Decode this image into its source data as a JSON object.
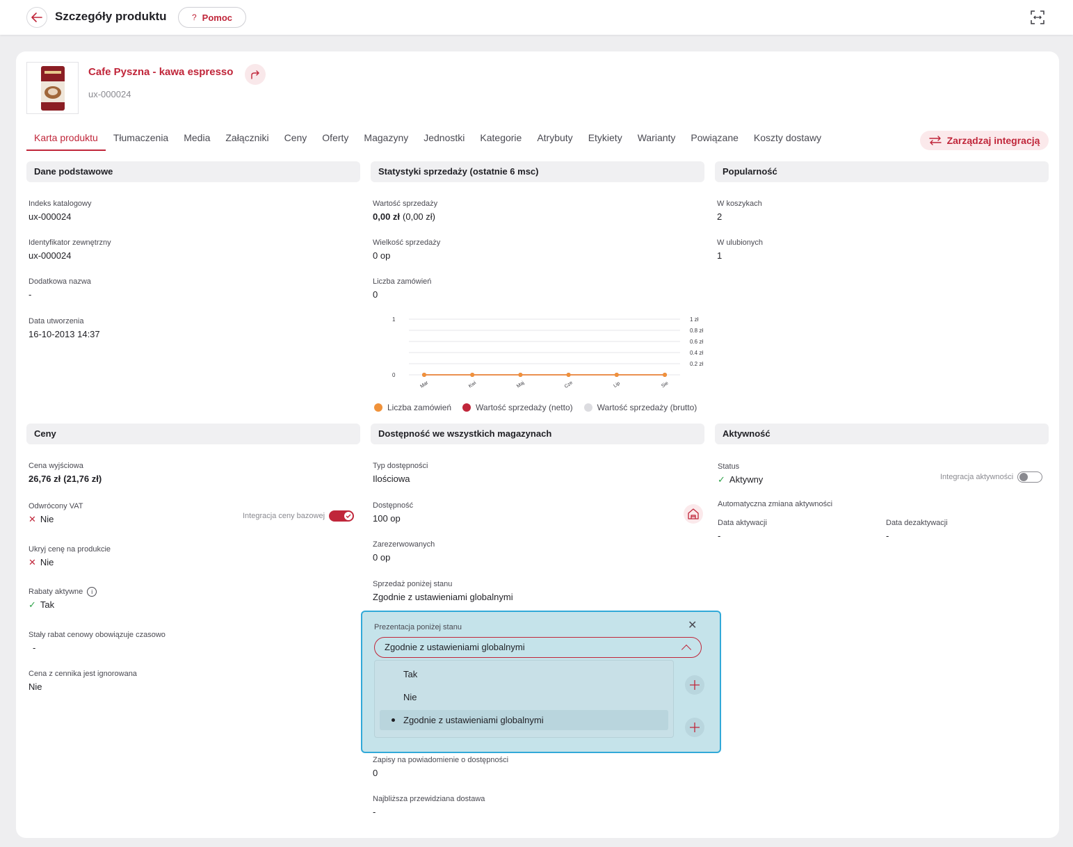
{
  "header": {
    "title": "Szczegóły produktu",
    "help_label": "Pomoc",
    "help_glyph": "?"
  },
  "product": {
    "name": "Cafe Pyszna - kawa espresso",
    "sku": "ux-000024"
  },
  "tabs": [
    {
      "label": "Karta produktu",
      "active": true
    },
    {
      "label": "Tłumaczenia"
    },
    {
      "label": "Media"
    },
    {
      "label": "Załączniki"
    },
    {
      "label": "Ceny"
    },
    {
      "label": "Oferty"
    },
    {
      "label": "Magazyny"
    },
    {
      "label": "Jednostki"
    },
    {
      "label": "Kategorie"
    },
    {
      "label": "Atrybuty"
    },
    {
      "label": "Etykiety"
    },
    {
      "label": "Warianty"
    },
    {
      "label": "Powiązane"
    },
    {
      "label": "Koszty dostawy"
    }
  ],
  "integration_button": "Zarządzaj integracją",
  "basic": {
    "title": "Dane podstawowe",
    "catalog_index_label": "Indeks katalogowy",
    "catalog_index": "ux-000024",
    "external_id_label": "Identyfikator zewnętrzny",
    "external_id": "ux-000024",
    "extra_name_label": "Dodatkowa nazwa",
    "extra_name": "-",
    "created_label": "Data utworzenia",
    "created": "16-10-2013 14:37"
  },
  "sales": {
    "title": "Statystyki sprzedaży (ostatnie 6 msc)",
    "value_label": "Wartość sprzedaży",
    "value_main": "0,00 zł",
    "value_extra": "(0,00 zł)",
    "volume_label": "Wielkość sprzedaży",
    "volume": "0 op",
    "orders_label": "Liczba zamówień",
    "orders": "0"
  },
  "popularity": {
    "title": "Popularność",
    "carts_label": "W koszykach",
    "carts": "2",
    "favs_label": "W ulubionych",
    "favs": "1"
  },
  "prices": {
    "title": "Ceny",
    "base_price_label": "Cena wyjściowa",
    "base_price_main": "26,76 zł",
    "base_price_extra": "(21,76 zł)",
    "reverse_vat_label": "Odwrócony VAT",
    "reverse_vat": "Nie",
    "base_integration_label": "Integracja ceny bazowej",
    "hide_price_label": "Ukryj cenę na produkcie",
    "hide_price": "Nie",
    "discounts_label": "Rabaty aktywne",
    "discounts": "Tak",
    "fixed_discount_label": "Stały rabat cenowy obowiązuje czasowo",
    "fixed_discount": "-",
    "ignored_label": "Cena z cennika jest ignorowana",
    "ignored": "Nie"
  },
  "availability": {
    "title": "Dostępność we wszystkich magazynach",
    "type_label": "Typ dostępności",
    "type": "Ilościowa",
    "avail_label": "Dostępność",
    "avail": "100 op",
    "reserved_label": "Zarezerwowanych",
    "reserved": "0 op",
    "below_label": "Sprzedaż poniżej stanu",
    "below": "Zgodnie z ustawieniami globalnymi",
    "notify_label": "Zapisy na powiadomienie o dostępności",
    "notify": "0",
    "next_delivery_label": "Najbliższa przewidziana dostawa",
    "next_delivery": "-"
  },
  "activity": {
    "title": "Aktywność",
    "status_label": "Status",
    "status": "Aktywny",
    "integration_label": "Integracja aktywności",
    "auto_label": "Automatyczna zmiana aktywności",
    "activation_label": "Data aktywacji",
    "activation": "-",
    "deactivation_label": "Data dezaktywacji",
    "deactivation": "-"
  },
  "popup": {
    "label": "Prezentacja poniżej stanu",
    "selected": "Zgodnie z ustawieniami globalnymi",
    "options": [
      "Tak",
      "Nie",
      "Zgodnie z ustawieniami globalnymi"
    ]
  },
  "colors": {
    "accent": "#c0263a",
    "orders_series": "#f0923a",
    "net_series": "#c0263a",
    "gross_series": "#dcdce0",
    "popup_border": "#31a9d8"
  },
  "chart_data": {
    "type": "line",
    "categories": [
      "Mar",
      "Kwi",
      "Maj",
      "Cze",
      "Lip",
      "Sie"
    ],
    "series": [
      {
        "name": "Liczba zamówień",
        "values": [
          0,
          0,
          0,
          0,
          0,
          0
        ],
        "axis": "left"
      },
      {
        "name": "Wartość sprzedaży (netto)",
        "values": [
          0,
          0,
          0,
          0,
          0,
          0
        ],
        "axis": "right"
      },
      {
        "name": "Wartość sprzedaży (brutto)",
        "values": [
          0,
          0,
          0,
          0,
          0,
          0
        ],
        "axis": "right"
      }
    ],
    "left_axis": {
      "ticks": [
        "1",
        "0"
      ],
      "ylim": [
        0,
        1
      ]
    },
    "right_axis": {
      "ticks": [
        "1 zł",
        "0.8 zł",
        "0.6 zł",
        "0.4 zł",
        "0.2 zł"
      ],
      "ylim": [
        0,
        1
      ]
    },
    "legend_position": "bottom"
  }
}
